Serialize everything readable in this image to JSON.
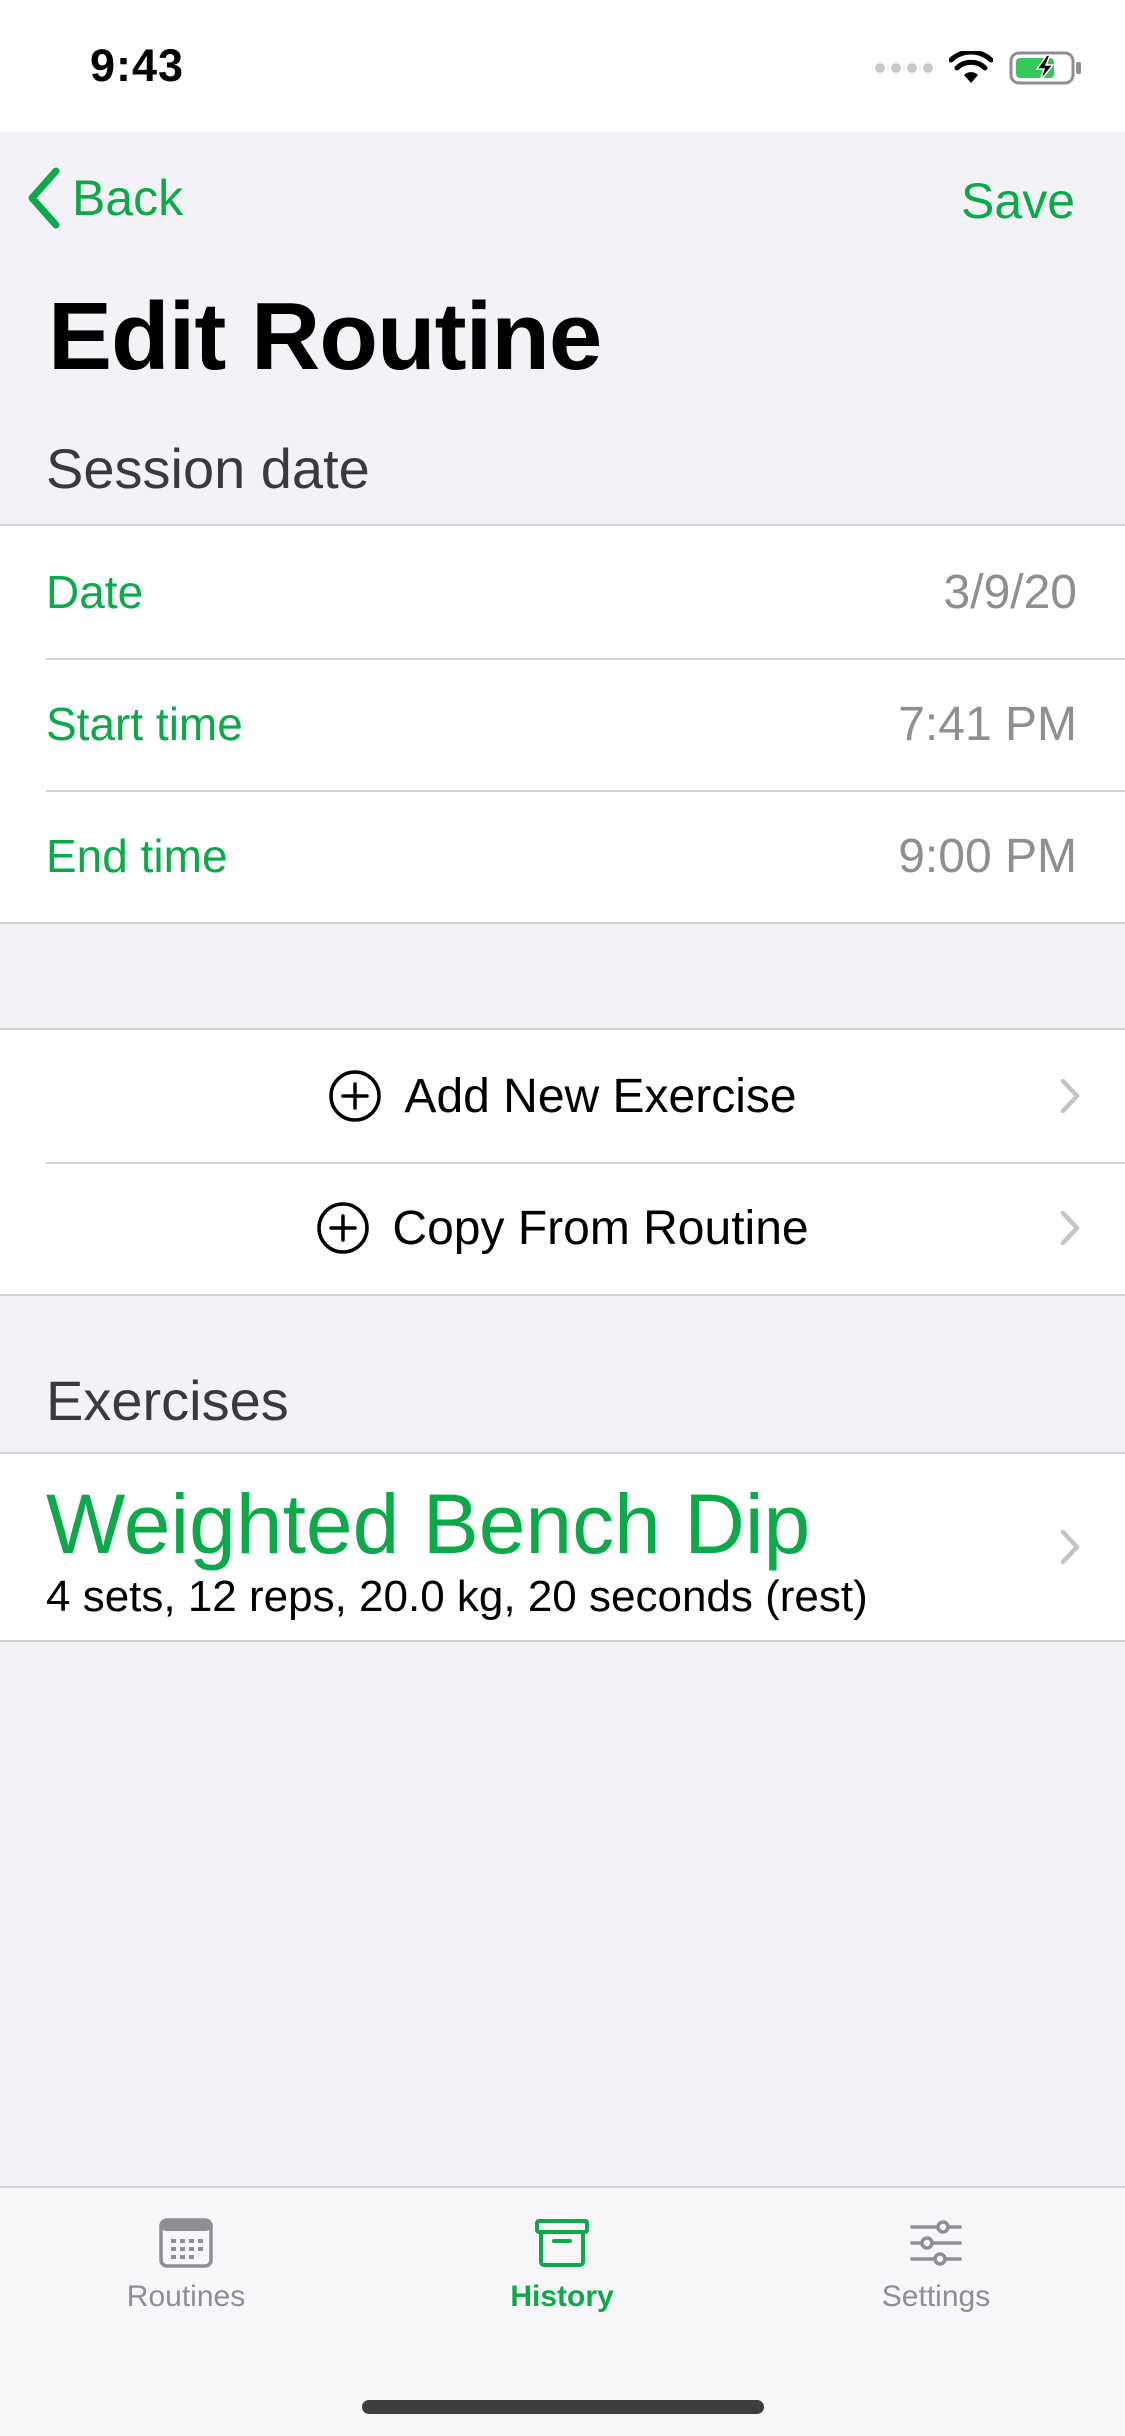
{
  "status_bar": {
    "time": "9:43"
  },
  "nav": {
    "back_label": "Back",
    "save_label": "Save"
  },
  "page_title": "Edit Routine",
  "session": {
    "header": "Session date",
    "rows": [
      {
        "label": "Date",
        "value": "3/9/20"
      },
      {
        "label": "Start time",
        "value": "7:41 PM"
      },
      {
        "label": "End time",
        "value": "9:00 PM"
      }
    ]
  },
  "actions": [
    {
      "label": "Add New Exercise",
      "icon": "plus-circle-icon"
    },
    {
      "label": "Copy From Routine",
      "icon": "plus-circle-icon"
    }
  ],
  "exercises": {
    "header": "Exercises",
    "items": [
      {
        "name": "Weighted Bench Dip",
        "detail": "4 sets, 12 reps, 20.0 kg, 20 seconds (rest)"
      }
    ]
  },
  "tab_bar": {
    "tabs": [
      {
        "label": "Routines",
        "icon": "calendar-icon",
        "active": false
      },
      {
        "label": "History",
        "icon": "archive-box-icon",
        "active": true
      },
      {
        "label": "Settings",
        "icon": "sliders-icon",
        "active": false
      }
    ]
  },
  "colors": {
    "accent": "#0aaa48",
    "background": "#f2f2f7",
    "separator": "#d1d1d6",
    "secondary_text": "#8e8e93"
  }
}
